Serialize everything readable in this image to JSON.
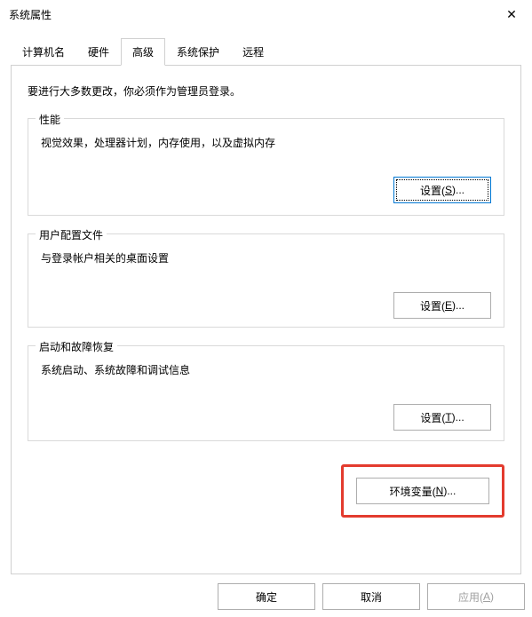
{
  "titlebar": {
    "title": "系统属性"
  },
  "tabs": {
    "computer_name": "计算机名",
    "hardware": "硬件",
    "advanced": "高级",
    "system_protection": "系统保护",
    "remote": "远程"
  },
  "content": {
    "intro": "要进行大多数更改，你必须作为管理员登录。",
    "performance": {
      "title": "性能",
      "desc": "视觉效果，处理器计划，内存使用，以及虚拟内存",
      "button_prefix": "设置(",
      "button_key": "S",
      "button_suffix": ")..."
    },
    "user_profiles": {
      "title": "用户配置文件",
      "desc": "与登录帐户相关的桌面设置",
      "button_prefix": "设置(",
      "button_key": "E",
      "button_suffix": ")..."
    },
    "startup": {
      "title": "启动和故障恢复",
      "desc": "系统启动、系统故障和调试信息",
      "button_prefix": "设置(",
      "button_key": "T",
      "button_suffix": ")..."
    },
    "env_vars": {
      "button_prefix": "环境变量(",
      "button_key": "N",
      "button_suffix": ")..."
    }
  },
  "buttons": {
    "ok": "确定",
    "cancel": "取消",
    "apply_prefix": "应用(",
    "apply_key": "A",
    "apply_suffix": ")"
  }
}
